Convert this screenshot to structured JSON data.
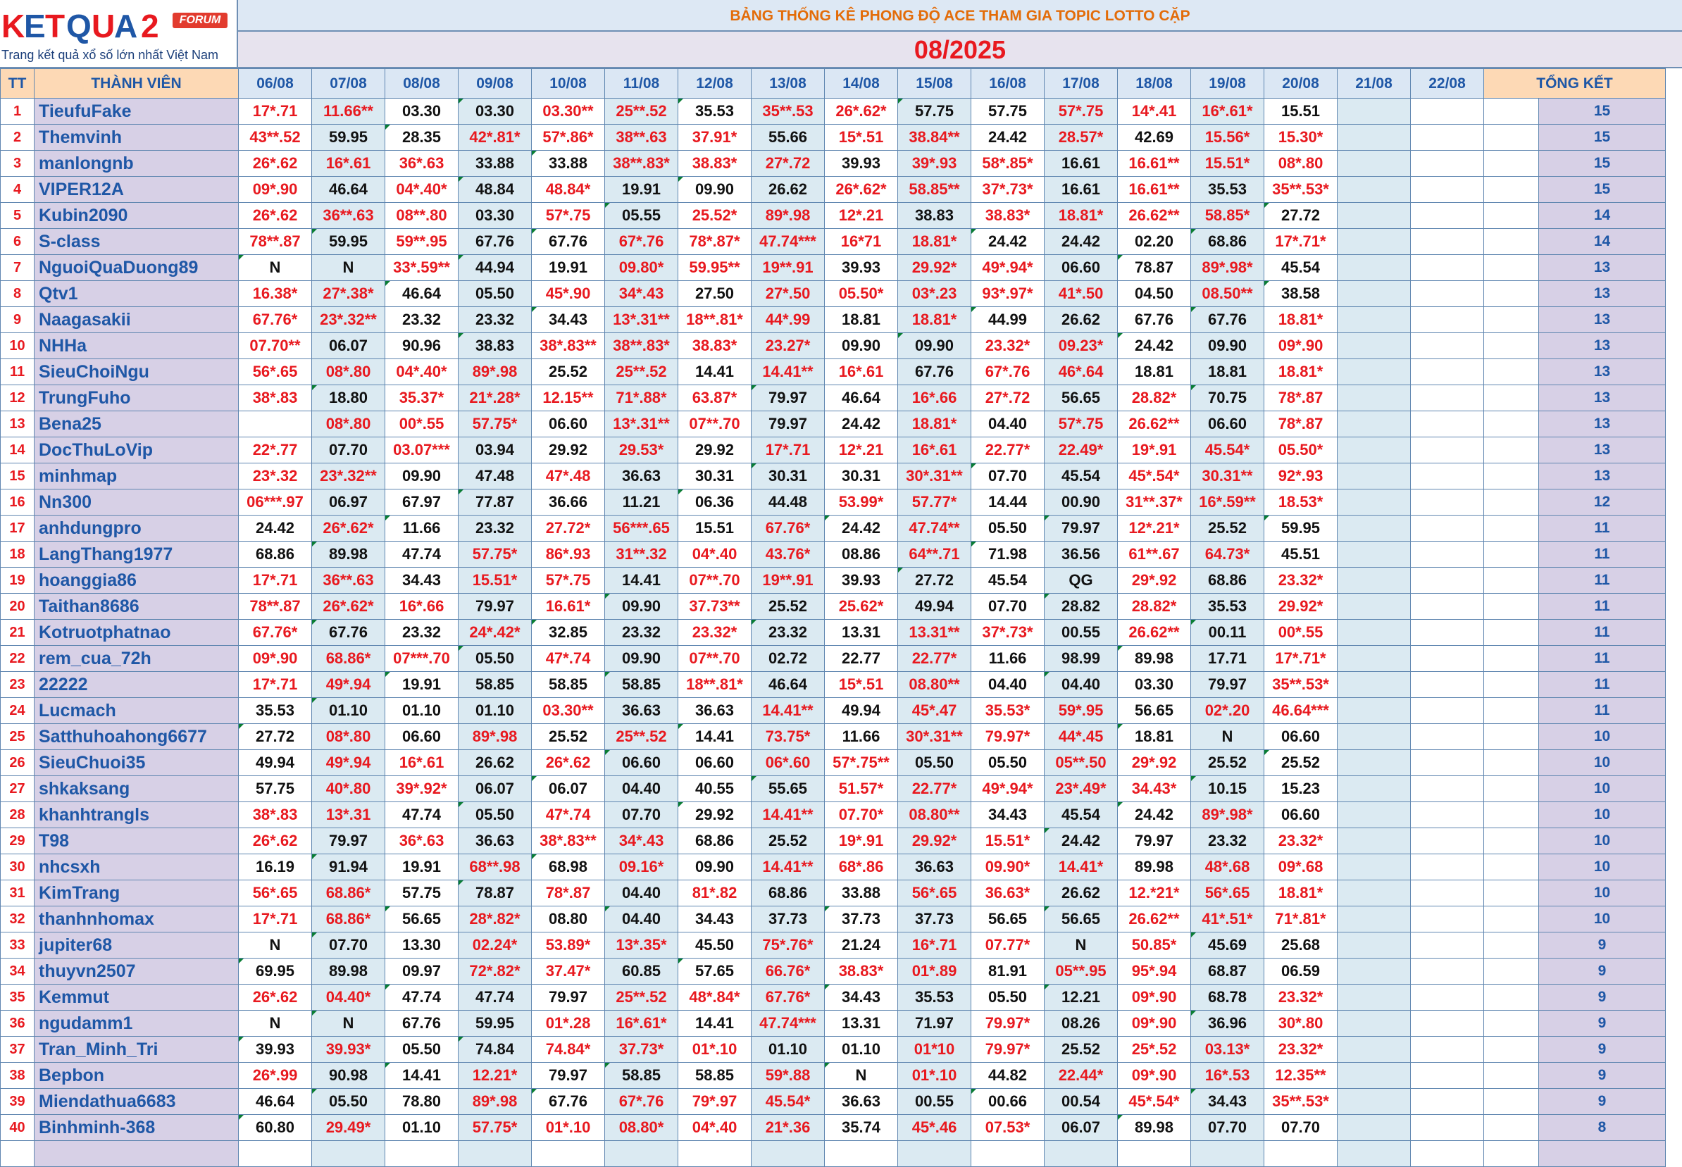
{
  "logo": {
    "letters": [
      {
        "ch": "K",
        "color": "#e8191f"
      },
      {
        "ch": "E",
        "color": "#1f57a6"
      },
      {
        "ch": "T",
        "color": "#e8191f"
      },
      {
        "ch": "Q",
        "color": "#1f57a6"
      },
      {
        "ch": "U",
        "color": "#e8191f"
      },
      {
        "ch": "A",
        "color": "#1f57a6"
      },
      {
        "ch": "2",
        "color": "#e8191f"
      }
    ],
    "forum": "FORUM",
    "tagline": "Trang kết quả xổ số lớn nhất Việt Nam"
  },
  "title": "BẢNG THỐNG KÊ PHONG ĐỘ ACE THAM GIA TOPIC  LOTTO CẶP",
  "month": "08/2025",
  "headers": {
    "tt": "TT",
    "member": "THÀNH VIÊN",
    "total": "TỔNG KẾT"
  },
  "dates": [
    "06/08",
    "07/08",
    "08/08",
    "09/08",
    "10/08",
    "11/08",
    "12/08",
    "13/08",
    "14/08",
    "15/08",
    "16/08",
    "17/08",
    "18/08",
    "19/08",
    "20/08",
    "21/08",
    "22/08"
  ],
  "rows": [
    {
      "tt": "1",
      "name": "TieufuFake",
      "cells": [
        "17*.71",
        "11.66**",
        "03.30",
        "03.30",
        "03.30**",
        "25**.52",
        "35.53",
        "35**.53",
        "26*.62*",
        "57.75",
        "57.75",
        "57*.75",
        "14*.41",
        "16*.61*",
        "15.51",
        "",
        ""
      ],
      "total": "15"
    },
    {
      "tt": "2",
      "name": "Themvinh",
      "cells": [
        "43**.52",
        "59.95",
        "28.35",
        "42*.81*",
        "57*.86*",
        "38**.63",
        "37.91*",
        "55.66",
        "15*.51",
        "38.84**",
        "24.42",
        "28.57*",
        "42.69",
        "15.56*",
        "15.30*",
        "",
        ""
      ],
      "total": "15"
    },
    {
      "tt": "3",
      "name": "manlongnb",
      "cells": [
        "26*.62",
        "16*.61",
        "36*.63",
        "33.88",
        "33.88",
        "38**.83*",
        "38.83*",
        "27*.72",
        "39.93",
        "39*.93",
        "58*.85*",
        "16.61",
        "16.61**",
        "15.51*",
        "08*.80",
        "",
        ""
      ],
      "total": "15"
    },
    {
      "tt": "4",
      "name": "VIPER12A",
      "cells": [
        "09*.90",
        "46.64",
        "04*.40*",
        "48.84",
        "48.84*",
        "19.91",
        "09.90",
        "26.62",
        "26*.62*",
        "58.85**",
        "37*.73*",
        "16.61",
        "16.61**",
        "35.53",
        "35**.53*",
        "",
        ""
      ],
      "total": "15"
    },
    {
      "tt": "5",
      "name": "Kubin2090",
      "cells": [
        "26*.62",
        "36**.63",
        "08**.80",
        "03.30",
        "57*.75",
        "05.55",
        "25.52*",
        "89*.98",
        "12*.21",
        "38.83",
        "38.83*",
        "18.81*",
        "26.62**",
        "58.85*",
        "27.72",
        "",
        ""
      ],
      "total": "14"
    },
    {
      "tt": "6",
      "name": "S-class",
      "cells": [
        "78**.87",
        "59.95",
        "59**.95",
        "67.76",
        "67.76",
        "67*.76",
        "78*.87*",
        "47.74***",
        "16*71",
        "18.81*",
        "24.42",
        "24.42",
        "02.20",
        "68.86",
        "17*.71*",
        "",
        ""
      ],
      "total": "14"
    },
    {
      "tt": "7",
      "name": "NguoiQuaDuong89",
      "cells": [
        "N",
        "N",
        "33*.59**",
        "44.94",
        "19.91",
        "09.80*",
        "59.95**",
        "19**.91",
        "39.93",
        "29.92*",
        "49*.94*",
        "06.60",
        "78.87",
        "89*.98*",
        "45.54",
        "",
        ""
      ],
      "total": "13"
    },
    {
      "tt": "8",
      "name": "Qtv1",
      "cells": [
        "16.38*",
        "27*.38*",
        "46.64",
        "05.50",
        "45*.90",
        "34*.43",
        "27.50",
        "27*.50",
        "05.50*",
        "03*.23",
        "93*.97*",
        "41*.50",
        "04.50",
        "08.50**",
        "38.58",
        "",
        ""
      ],
      "total": "13"
    },
    {
      "tt": "9",
      "name": "Naagasakii",
      "cells": [
        "67.76*",
        "23*.32**",
        "23.32",
        "23.32",
        "34.43",
        "13*.31**",
        "18**.81*",
        "44*.99",
        "18.81",
        "18.81*",
        "44.99",
        "26.62",
        "67.76",
        "67.76",
        "18.81*",
        "",
        ""
      ],
      "total": "13"
    },
    {
      "tt": "10",
      "name": "NHHa",
      "cells": [
        "07.70**",
        "06.07",
        "90.96",
        "38.83",
        "38*.83**",
        "38**.83*",
        "38.83*",
        "23.27*",
        "09.90",
        "09.90",
        "23.32*",
        "09.23*",
        "24.42",
        "09.90",
        "09*.90",
        "",
        ""
      ],
      "total": "13"
    },
    {
      "tt": "11",
      "name": "SieuChoiNgu",
      "cells": [
        "56*.65",
        "08*.80",
        "04*.40*",
        "89*.98",
        "25.52",
        "25**.52",
        "14.41",
        "14.41**",
        "16*.61",
        "67.76",
        "67*.76",
        "46*.64",
        "18.81",
        "18.81",
        "18.81*",
        "",
        ""
      ],
      "total": "13"
    },
    {
      "tt": "12",
      "name": "TrungFuho",
      "cells": [
        "38*.83",
        "18.80",
        "35.37*",
        "21*.28*",
        "12.15**",
        "71*.88*",
        "63.87*",
        "79.97",
        "46.64",
        "16*.66",
        "27*.72",
        "56.65",
        "28.82*",
        "70.75",
        "78*.87",
        "",
        ""
      ],
      "total": "13"
    },
    {
      "tt": "13",
      "name": "Bena25",
      "cells": [
        "",
        "08*.80",
        "00*.55",
        "57.75*",
        "06.60",
        "13*.31**",
        "07**.70",
        "79.97",
        "24.42",
        "18.81*",
        "04.40",
        "57*.75",
        "26.62**",
        "06.60",
        "78*.87",
        "",
        ""
      ],
      "total": "13"
    },
    {
      "tt": "14",
      "name": "DocThuLoVip",
      "cells": [
        "22*.77",
        "07.70",
        "03.07***",
        "03.94",
        "29.92",
        "29.53*",
        "29.92",
        "17*.71",
        "12*.21",
        "16*.61",
        "22.77*",
        "22.49*",
        "19*.91",
        "45.54*",
        "05.50*",
        "",
        ""
      ],
      "total": "13"
    },
    {
      "tt": "15",
      "name": "minhmap",
      "cells": [
        "23*.32",
        "23*.32**",
        "09.90",
        "47.48",
        "47*.48",
        "36.63",
        "30.31",
        "30.31",
        "30.31",
        "30*.31**",
        "07.70",
        "45.54",
        "45*.54*",
        "30.31**",
        "92*.93",
        "",
        ""
      ],
      "total": "13"
    },
    {
      "tt": "16",
      "name": "Nn300",
      "cells": [
        "06***.97",
        "06.97",
        "67.97",
        "77.87",
        "36.66",
        "11.21",
        "06.36",
        "44.48",
        "53.99*",
        "57.77*",
        "14.44",
        "00.90",
        "31**.37*",
        "16*.59**",
        "18.53*",
        "",
        ""
      ],
      "total": "12"
    },
    {
      "tt": "17",
      "name": "anhdungpro",
      "cells": [
        "24.42",
        "26*.62*",
        "11.66",
        "23.32",
        "27.72*",
        "56***.65",
        "15.51",
        "67.76*",
        "24.42",
        "47.74**",
        "05.50",
        "79.97",
        "12*.21*",
        "25.52",
        "59.95",
        "",
        ""
      ],
      "total": "11"
    },
    {
      "tt": "18",
      "name": "LangThang1977",
      "cells": [
        "68.86",
        "89.98",
        "47.74",
        "57.75*",
        "86*.93",
        "31**.32",
        "04*.40",
        "43.76*",
        "08.86",
        "64**.71",
        "71.98",
        "36.56",
        "61**.67",
        "64.73*",
        "45.51",
        "",
        ""
      ],
      "total": "11"
    },
    {
      "tt": "19",
      "name": "hoanggia86",
      "cells": [
        "17*.71",
        "36**.63",
        "34.43",
        "15.51*",
        "57*.75",
        "14.41",
        "07**.70",
        "19**.91",
        "39.93",
        "27.72",
        "45.54",
        "QG",
        "29*.92",
        "68.86",
        "23.32*",
        "",
        ""
      ],
      "total": "11"
    },
    {
      "tt": "20",
      "name": "Taithan8686",
      "cells": [
        "78**.87",
        "26*.62*",
        "16*.66",
        "79.97",
        "16.61*",
        "09.90",
        "37.73**",
        "25.52",
        "25.62*",
        "49.94",
        "07.70",
        "28.82",
        "28.82*",
        "35.53",
        "29.92*",
        "",
        ""
      ],
      "total": "11"
    },
    {
      "tt": "21",
      "name": "Kotruotphatnao",
      "cells": [
        "67.76*",
        "67.76",
        "23.32",
        "24*.42*",
        "32.85",
        "23.32",
        "23.32*",
        "23.32",
        "13.31",
        "13.31**",
        "37*.73*",
        "00.55",
        "26.62**",
        "00.11",
        "00*.55",
        "",
        ""
      ],
      "total": "11"
    },
    {
      "tt": "22",
      "name": "rem_cua_72h",
      "cells": [
        "09*.90",
        "68.86*",
        "07***.70",
        "05.50",
        "47*.74",
        "09.90",
        "07**.70",
        "02.72",
        "22.77",
        "22.77*",
        "11.66",
        "98.99",
        "89.98",
        "17.71",
        "17*.71*",
        "",
        ""
      ],
      "total": "11"
    },
    {
      "tt": "23",
      "name": "22222",
      "cells": [
        "17*.71",
        "49*.94",
        "19.91",
        "58.85",
        "58.85",
        "58.85",
        "18**.81*",
        "46.64",
        "15*.51",
        "08.80**",
        "04.40",
        "04.40",
        "03.30",
        "79.97",
        "35**.53*",
        "",
        ""
      ],
      "total": "11"
    },
    {
      "tt": "24",
      "name": "Lucmach",
      "cells": [
        "35.53",
        "01.10",
        "01.10",
        "01.10",
        "03.30**",
        "36.63",
        "36.63",
        "14.41**",
        "49.94",
        "45*.47",
        "35.53*",
        "59*.95",
        "56.65",
        "02*.20",
        "46.64***",
        "",
        ""
      ],
      "total": "11"
    },
    {
      "tt": "25",
      "name": "Satthuhoahong6677",
      "cells": [
        "27.72",
        "08*.80",
        "06.60",
        "89*.98",
        "25.52",
        "25**.52",
        "14.41",
        "73.75*",
        "11.66",
        "30*.31**",
        "79.97*",
        "44*.45",
        "18.81",
        "N",
        "06.60",
        "",
        ""
      ],
      "total": "10"
    },
    {
      "tt": "26",
      "name": "SieuChuoi35",
      "cells": [
        "49.94",
        "49*.94",
        "16*.61",
        "26.62",
        "26*.62",
        "06.60",
        "06.60",
        "06*.60",
        "57*.75**",
        "05.50",
        "05.50",
        "05**.50",
        "29*.92",
        "25.52",
        "25.52",
        "",
        ""
      ],
      "total": "10"
    },
    {
      "tt": "27",
      "name": "shkaksang",
      "cells": [
        "57.75",
        "40*.80",
        "39*.92*",
        "06.07",
        "06.07",
        "04.40",
        "40.55",
        "55.65",
        "51.57*",
        "22.77*",
        "49*.94*",
        "23*.49*",
        "34.43*",
        "10.15",
        "15.23",
        "",
        ""
      ],
      "total": "10"
    },
    {
      "tt": "28",
      "name": "khanhtrangls",
      "cells": [
        "38*.83",
        "13*.31",
        "47.74",
        "05.50",
        "47*.74",
        "07.70",
        "29.92",
        "14.41**",
        "07.70*",
        "08.80**",
        "34.43",
        "45.54",
        "24.42",
        "89*.98*",
        "06.60",
        "",
        ""
      ],
      "total": "10"
    },
    {
      "tt": "29",
      "name": "T98",
      "cells": [
        "26*.62",
        "79.97",
        "36*.63",
        "36.63",
        "38*.83**",
        "34*.43",
        "68.86",
        "25.52",
        "19*.91",
        "29.92*",
        "15.51*",
        "24.42",
        "79.97",
        "23.32",
        "23.32*",
        "",
        ""
      ],
      "total": "10"
    },
    {
      "tt": "30",
      "name": "nhcsxh",
      "cells": [
        "16.19",
        "91.94",
        "19.91",
        "68**.98",
        "68.98",
        "09.16*",
        "09.90",
        "14.41**",
        "68*.86",
        "36.63",
        "09.90*",
        "14.41*",
        "89.98",
        "48*.68",
        "09*.68",
        "",
        ""
      ],
      "total": "10"
    },
    {
      "tt": "31",
      "name": "KimTrang",
      "cells": [
        "56*.65",
        "68.86*",
        "57.75",
        "78.87",
        "78*.87",
        "04.40",
        "81*.82",
        "68.86",
        "33.88",
        "56*.65",
        "36.63*",
        "26.62",
        "12.*21*",
        "56*.65",
        "18.81*",
        "",
        ""
      ],
      "total": "10"
    },
    {
      "tt": "32",
      "name": "thanhnhomax",
      "cells": [
        "17*.71",
        "68.86*",
        "56.65",
        "28*.82*",
        "08.80",
        "04.40",
        "34.43",
        "37.73",
        "37.73",
        "37.73",
        "56.65",
        "56.65",
        "26.62**",
        "41*.51*",
        "71*.81*",
        "",
        ""
      ],
      "total": "10"
    },
    {
      "tt": "33",
      "name": "jupiter68",
      "cells": [
        "N",
        "07.70",
        "13.30",
        "02.24*",
        "53.89*",
        "13*.35*",
        "45.50",
        "75*.76*",
        "21.24",
        "16*.71",
        "07.77*",
        "N",
        "50.85*",
        "45.69",
        "25.68",
        "",
        ""
      ],
      "total": "9"
    },
    {
      "tt": "34",
      "name": "thuyvn2507",
      "cells": [
        "69.95",
        "89.98",
        "09.97",
        "72*.82*",
        "37.47*",
        "60.85",
        "57.65",
        "66.76*",
        "38.83*",
        "01*.89",
        "81.91",
        "05**.95",
        "95*.94",
        "68.87",
        "06.59",
        "",
        ""
      ],
      "total": "9"
    },
    {
      "tt": "35",
      "name": "Kemmut",
      "cells": [
        "26*.62",
        "04.40*",
        "47.74",
        "47.74",
        "79.97",
        "25**.52",
        "48*.84*",
        "67.76*",
        "34.43",
        "35.53",
        "05.50",
        "12.21",
        "09*.90",
        "68.78",
        "23.32*",
        "",
        ""
      ],
      "total": "9"
    },
    {
      "tt": "36",
      "name": "ngudamm1",
      "cells": [
        "N",
        "N",
        "67.76",
        "59.95",
        "01*.28",
        "16*.61*",
        "14.41",
        "47.74***",
        "13.31",
        "71.97",
        "79.97*",
        "08.26",
        "09*.90",
        "36.96",
        "30*.80",
        "",
        ""
      ],
      "total": "9"
    },
    {
      "tt": "37",
      "name": "Tran_Minh_Tri",
      "cells": [
        "39.93",
        "39.93*",
        "05.50",
        "74.84",
        "74.84*",
        "37.73*",
        "01*.10",
        "01.10",
        "01.10",
        "01*10",
        "79.97*",
        "25.52",
        "25*.52",
        "03.13*",
        "23.32*",
        "",
        ""
      ],
      "total": "9"
    },
    {
      "tt": "38",
      "name": "Bepbon",
      "cells": [
        "26*.99",
        "90.98",
        "14.41",
        "12.21*",
        "79.97",
        "58.85",
        "58.85",
        "59*.88",
        "N",
        "01*.10",
        "44.82",
        "22.44*",
        "09*.90",
        "16*.53",
        "12.35**",
        "",
        ""
      ],
      "total": "9"
    },
    {
      "tt": "39",
      "name": "Miendathua6683",
      "cells": [
        "46.64",
        "05.50",
        "78.80",
        "89*.98",
        "67.76",
        "67*.76",
        "79*.97",
        "45.54*",
        "36.63",
        "00.55",
        "00.66",
        "00.54",
        "45*.54*",
        "34.43",
        "35**.53*",
        "",
        ""
      ],
      "total": "9"
    },
    {
      "tt": "40",
      "name": "Binhminh-368",
      "cells": [
        "60.80",
        "29.49*",
        "01.10",
        "57.75*",
        "01*.10",
        "08.80*",
        "04*.40",
        "21*.36",
        "35.74",
        "45*.46",
        "07.53*",
        "06.07",
        "89.98",
        "07.70",
        "07.70",
        "",
        ""
      ],
      "total": "8"
    }
  ]
}
